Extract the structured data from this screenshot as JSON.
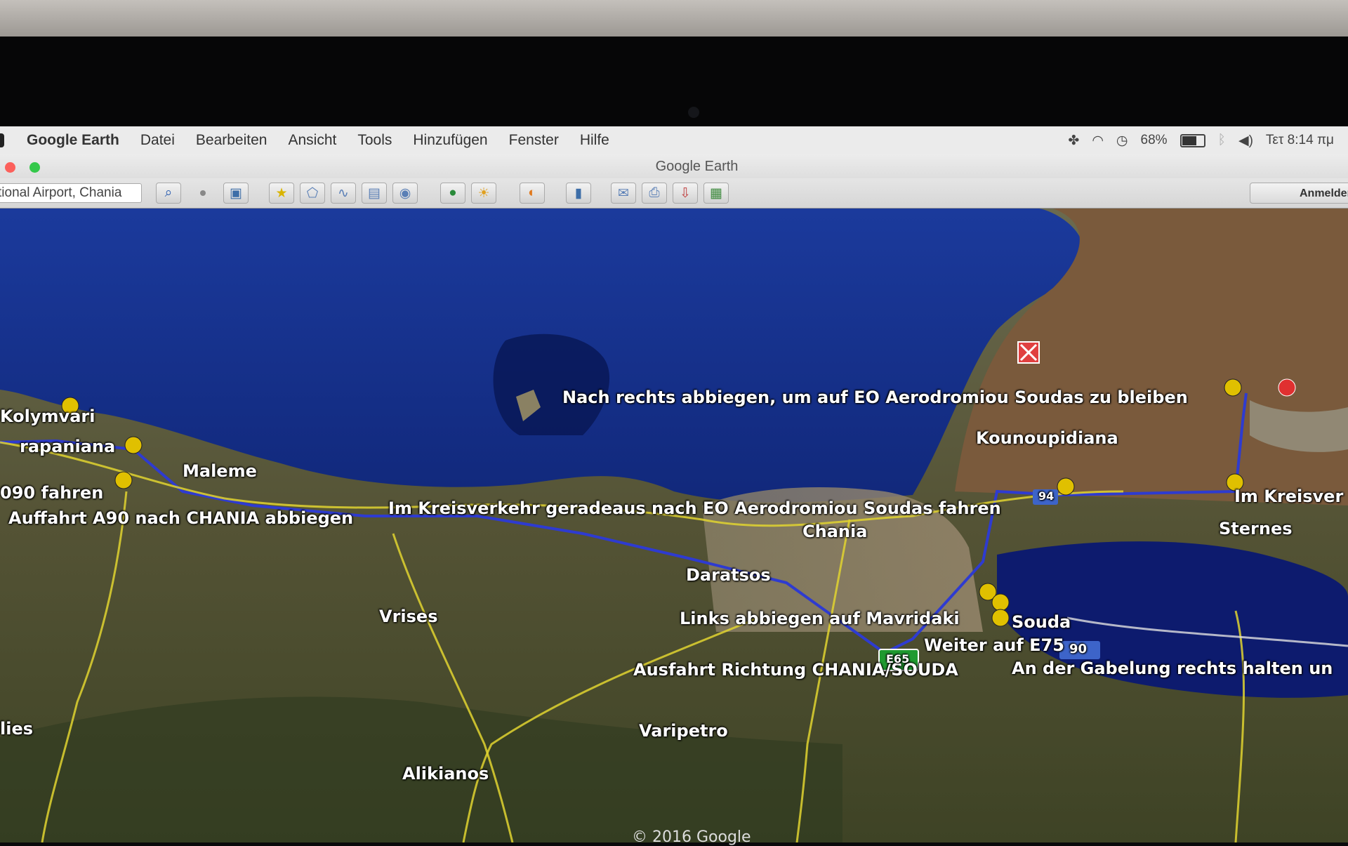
{
  "menubar": {
    "app_name": "Google Earth",
    "items": [
      "Datei",
      "Bearbeiten",
      "Ansicht",
      "Tools",
      "Hinzufügen",
      "Fenster",
      "Hilfe"
    ],
    "battery": "68%",
    "clock": "Τετ 8:14 πμ"
  },
  "window": {
    "title": "Google Earth",
    "search_value": "tional Airport, Chania",
    "sign_in": "Anmelden"
  },
  "map": {
    "route_directions": [
      "Nach rechts abbiegen, um auf EO Aerodromiou Soudas zu bleiben",
      "Im Kreisverkehr geradeaus nach EO Aerodromiou Soudas fahren",
      "Auffahrt A90 nach CHANIA abbiegen",
      "090 fahren",
      "Links abbiegen auf Mavridaki",
      "Weiter auf E75",
      "Ausfahrt Richtung CHANIA/SOUDA",
      "An der Gabelung rechts halten un",
      "Im Kreisver"
    ],
    "places": [
      "Kolymvari",
      "rapaniana",
      "Maleme",
      "Kounoupidiana",
      "Chania",
      "Daratsos",
      "Souda",
      "Sternes",
      "Vrises",
      "Varipetro",
      "Alikianos",
      "lies"
    ],
    "road_shields": [
      "94",
      "90",
      "E65"
    ],
    "copyright": "© 2016 Google"
  }
}
